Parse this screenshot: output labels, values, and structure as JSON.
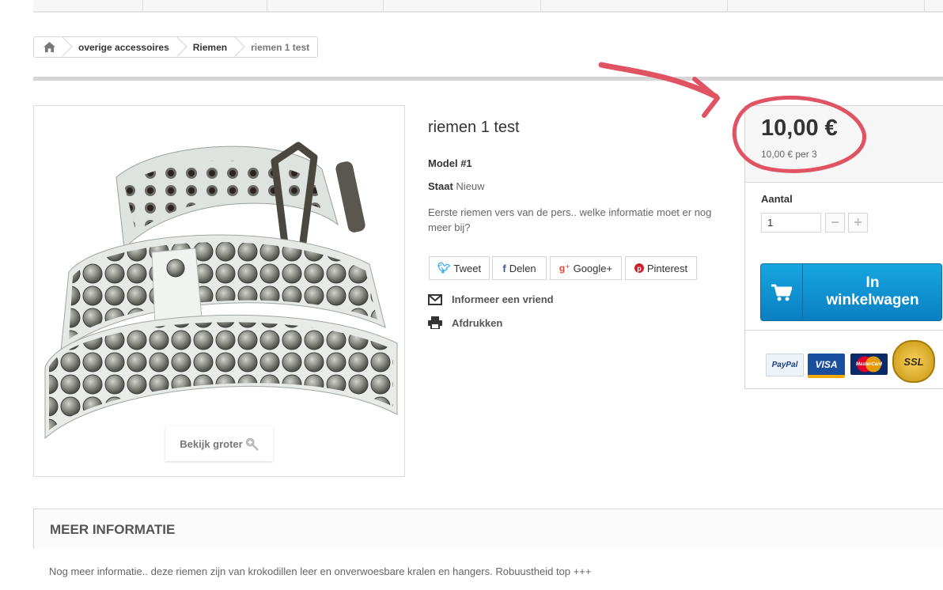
{
  "breadcrumb": {
    "items": [
      "overige accessoires",
      "Riemen"
    ],
    "current": "riemen 1 test"
  },
  "product": {
    "title": "riemen 1 test",
    "model_label": "Model",
    "model_value": "#1",
    "condition_label": "Staat",
    "condition_value": "Nieuw",
    "description": "Eerste riemen vers van de pers.. welke informatie moet er nog meer bij?",
    "zoom_label": "Bekijk groter"
  },
  "share": {
    "tweet": "Tweet",
    "facebook": "Delen",
    "google": "Google+",
    "pinterest": "Pinterest"
  },
  "actions": {
    "inform_friend": "Informeer een vriend",
    "print": "Afdrukken"
  },
  "buy": {
    "price": "10,00 €",
    "unit_price": "10,00 € per 3",
    "quantity_label": "Aantal",
    "quantity_value": "1",
    "minus": "−",
    "plus": "+",
    "cart_line1": "In",
    "cart_line2": "winkelwagen"
  },
  "payment": {
    "paypal": "PayPal",
    "visa": "VISA",
    "mastercard": "MasterCard",
    "ssl": "SSL"
  },
  "more_info": {
    "heading": "MEER INFORMATIE",
    "text": "Nog meer informatie.. deze riemen zijn  van krokodillen leer en onverwoesbare kralen en hangers. Robuustheid top +++"
  },
  "colors": {
    "accent_blue": "#0a85c9",
    "annotation_red": "#e05363",
    "border": "#d6d4d4"
  }
}
